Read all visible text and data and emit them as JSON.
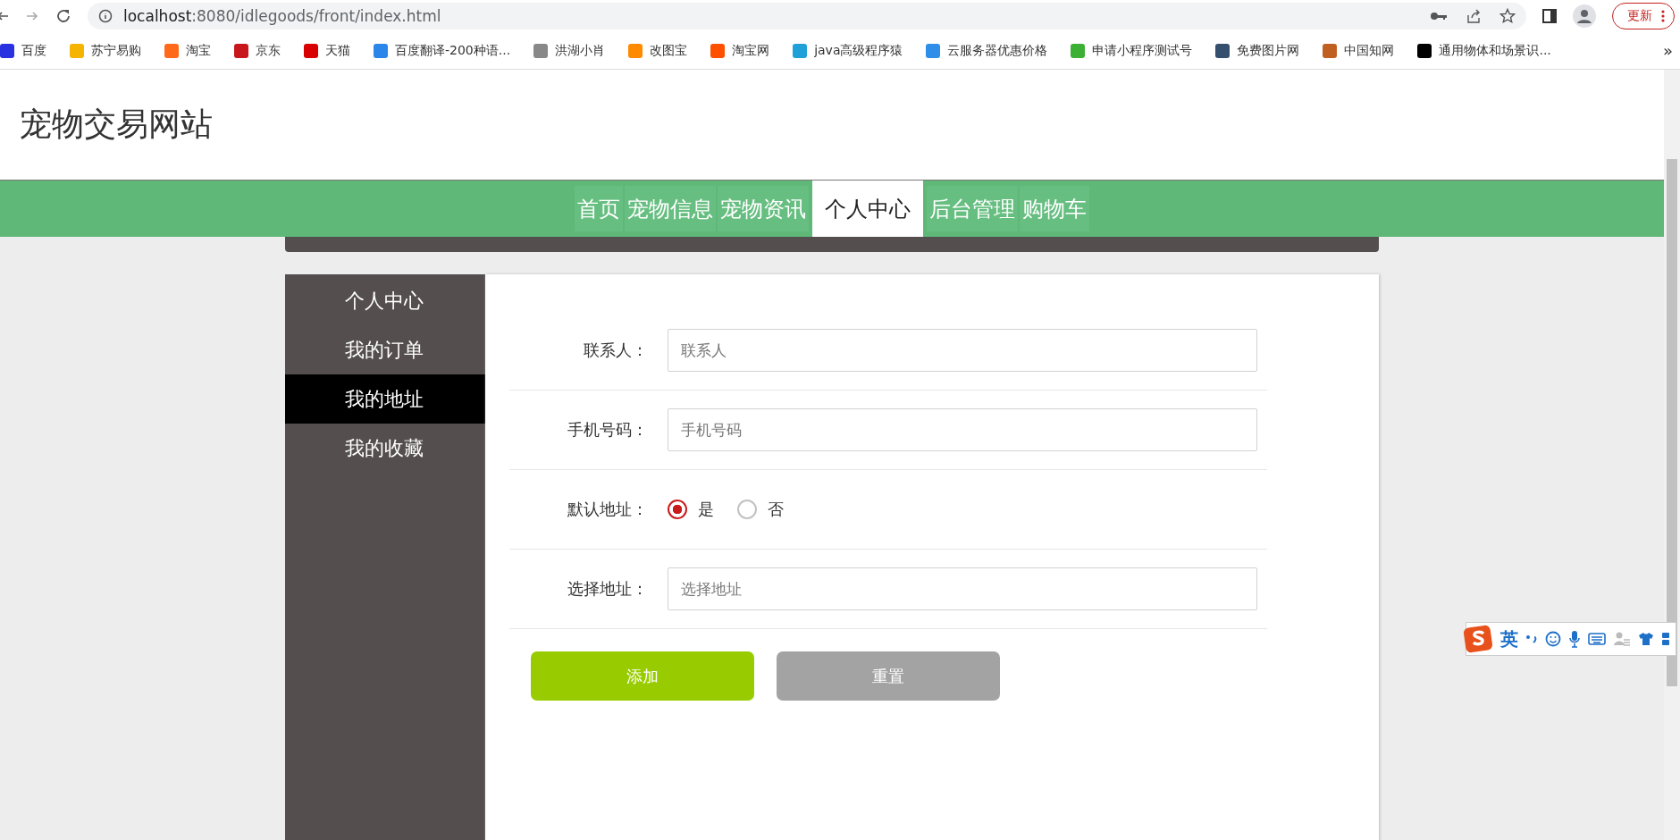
{
  "browser": {
    "url_host": "localhost",
    "url_rest": ":8080/idlegoods/front/index.html",
    "update_button": "更新",
    "bookmarks": [
      {
        "label": "百度",
        "color": "#2932e1"
      },
      {
        "label": "苏宁易购",
        "color": "#f5b400"
      },
      {
        "label": "淘宝",
        "color": "#ff6a1a"
      },
      {
        "label": "京东",
        "color": "#c8161d"
      },
      {
        "label": "天猫",
        "color": "#d80000"
      },
      {
        "label": "百度翻译-200种语...",
        "color": "#2a86e8"
      },
      {
        "label": "洪湖小肖",
        "color": "#888888"
      },
      {
        "label": "改图宝",
        "color": "#ff8a00"
      },
      {
        "label": "淘宝网",
        "color": "#ff5000"
      },
      {
        "label": "java高级程序猿",
        "color": "#20a0d8"
      },
      {
        "label": "云服务器优惠价格",
        "color": "#2f8fe8"
      },
      {
        "label": "申请小程序测试号",
        "color": "#3cb034"
      },
      {
        "label": "免费图片网",
        "color": "#34506e"
      },
      {
        "label": "中国知网",
        "color": "#c06020"
      },
      {
        "label": "通用物体和场景识...",
        "color": "#000000"
      }
    ],
    "more": "»"
  },
  "site_title": "宠物交易网站",
  "nav": [
    {
      "label": "首页",
      "selected": false
    },
    {
      "label": "宠物信息",
      "selected": false
    },
    {
      "label": "宠物资讯",
      "selected": false
    },
    {
      "label": "个人中心",
      "selected": true
    },
    {
      "label": "后台管理",
      "selected": false
    },
    {
      "label": "购物车",
      "selected": false
    }
  ],
  "sidebar": [
    {
      "label": "个人中心",
      "selected": false
    },
    {
      "label": "我的订单",
      "selected": false
    },
    {
      "label": "我的地址",
      "selected": true
    },
    {
      "label": "我的收藏",
      "selected": false
    }
  ],
  "form": [
    {
      "kind": "input",
      "label": "联系人：",
      "placeholder": "联系人"
    },
    {
      "kind": "input",
      "label": "手机号码：",
      "placeholder": "手机号码"
    },
    {
      "kind": "radio",
      "label": "默认地址：",
      "options": [
        {
          "label": "是",
          "selected": true
        },
        {
          "label": "否",
          "selected": false
        }
      ]
    },
    {
      "kind": "input",
      "label": "选择地址：",
      "placeholder": "选择地址"
    }
  ],
  "buttons": [
    {
      "kind": "primary",
      "label": "添加"
    },
    {
      "kind": "secondary",
      "label": "重置"
    }
  ],
  "ime": {
    "mode": "英"
  }
}
